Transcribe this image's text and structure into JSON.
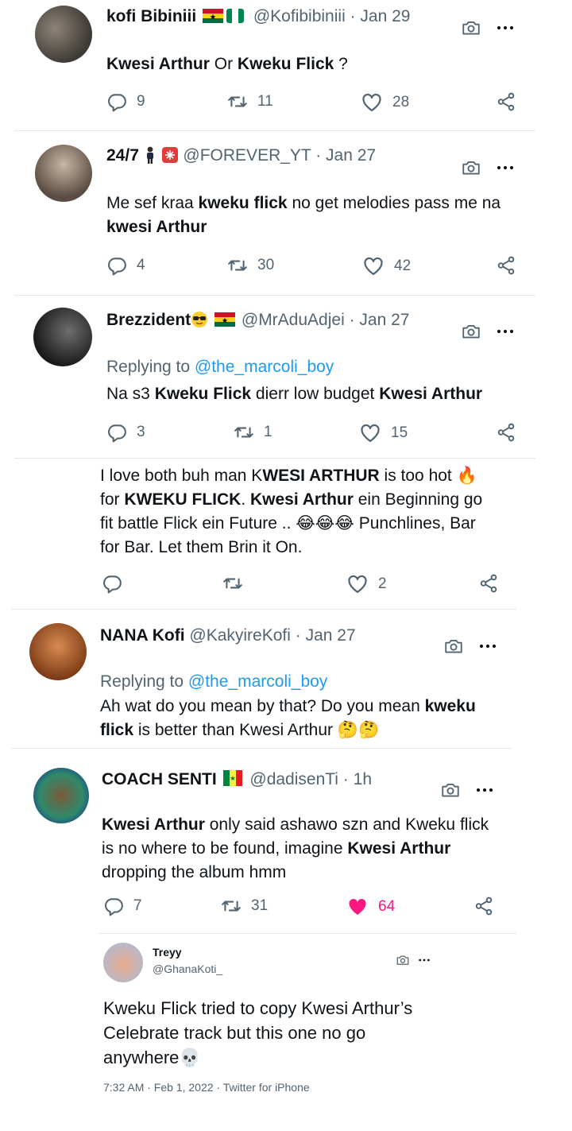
{
  "tweets": [
    {
      "name": "kofi Bibiniii",
      "handle": "@Kofibibiniii",
      "date": "Jan 29",
      "body": [
        {
          "t": "Kwesi Arthur",
          "b": true
        },
        {
          "t": "  Or ",
          "b": false
        },
        {
          "t": "Kweku Flick",
          "b": true
        },
        {
          "t": " ?",
          "b": false
        }
      ],
      "replies": "9",
      "retweets": "11",
      "likes": "28"
    },
    {
      "name": "24/7",
      "handle": "@FOREVER_YT",
      "date": "Jan 27",
      "body": [
        {
          "t": "Me sef kraa ",
          "b": false
        },
        {
          "t": "kweku flick",
          "b": true
        },
        {
          "t": " no get melodies pass me na ",
          "b": false
        },
        {
          "t": "kwesi Arthur",
          "b": true
        }
      ],
      "replies": "4",
      "retweets": "30",
      "likes": "42"
    },
    {
      "name": "Brezzident",
      "handle": "@MrAduAdjei",
      "date": "Jan 27",
      "replying_prefix": "Replying to ",
      "replying_to": "@the_marcoli_boy",
      "body": [
        {
          "t": "Na s3 ",
          "b": false
        },
        {
          "t": "Kweku Flick",
          "b": true
        },
        {
          "t": " dierr low budget ",
          "b": false
        },
        {
          "t": "Kwesi Arthur",
          "b": true
        }
      ],
      "replies": "3",
      "retweets": "1",
      "likes": "15"
    },
    {
      "body": [
        {
          "t": "I love both buh man K",
          "b": false
        },
        {
          "t": "WESI ARTHUR",
          "b": true
        },
        {
          "t": " is too hot 🔥 for ",
          "b": false
        },
        {
          "t": "KWEKU FLICK",
          "b": true
        },
        {
          "t": ". ",
          "b": false
        },
        {
          "t": "Kwesi Arthur",
          "b": true
        },
        {
          "t": " ein Beginning go fit battle Flick ein Future .. 😂😂😂 Punchlines, Bar for Bar. Let them Brin it On.",
          "b": false
        }
      ],
      "likes": "2"
    },
    {
      "name": "NANA Kofi",
      "handle": "@KakyireKofi",
      "date": "Jan 27",
      "replying_prefix": "Replying to ",
      "replying_to": "@the_marcoli_boy",
      "body": [
        {
          "t": "Ah wat do you mean by that? Do you mean ",
          "b": false
        },
        {
          "t": "kweku flick",
          "b": true
        },
        {
          "t": " is better than Kwesi Arthur 🤔🤔",
          "b": false
        }
      ]
    },
    {
      "name": "COACH SENTI",
      "handle": "@dadisenTi",
      "date": "1h",
      "body": [
        {
          "t": "Kwesi Arthur",
          "b": true
        },
        {
          "t": " only said ashawo szn and Kweku flick is no where to be found, imagine ",
          "b": false
        },
        {
          "t": "Kwesi Arthur",
          "b": true
        },
        {
          "t": " dropping the album hmm",
          "b": false
        }
      ],
      "replies": "7",
      "retweets": "31",
      "likes": "64"
    },
    {
      "name": "Treyy",
      "handle": "@GhanaKoti_",
      "body": [
        {
          "t": "Kweku Flick tried to copy Kwesi Arthur’s Celebrate track but this one no go anywhere💀",
          "b": false
        }
      ],
      "footer": "7:32 AM · Feb 1, 2022 · Twitter for iPhone"
    }
  ],
  "separator": " · ",
  "colors": {
    "text": "#0f1419",
    "muted": "#536471",
    "link": "#1d9bf0",
    "liked": "#f91880"
  },
  "icons": [
    "camera-icon",
    "more-icon",
    "reply-icon",
    "retweet-icon",
    "like-icon",
    "share-icon"
  ]
}
